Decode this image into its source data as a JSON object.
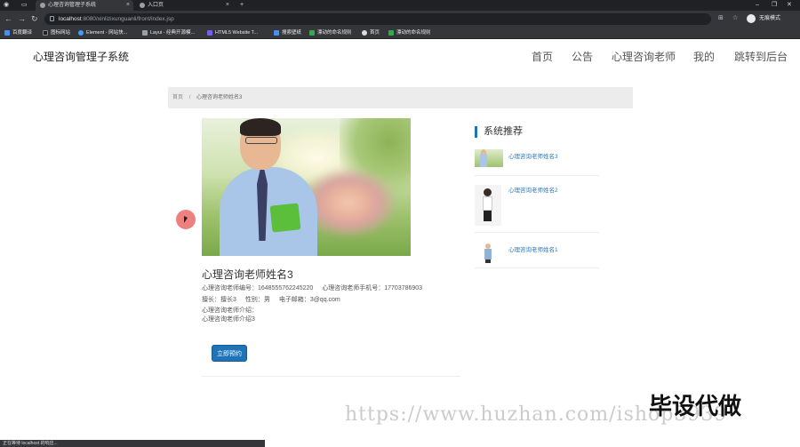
{
  "browser": {
    "tabs": [
      {
        "title": "心理咨询管理子系统"
      },
      {
        "title": "入口页"
      }
    ],
    "new_tab": "+",
    "url_host": "localhost",
    "url_path": ":8080/xinlizixunguanli/front/index.jsp",
    "profile_label": "无痕模式",
    "bookmarks": [
      "百度翻译",
      "图标网站",
      "Element - 网站快...",
      "Layui - 经典开源模...",
      "HTML5 Website T...",
      "搜索壁纸",
      "漂动的命名规则",
      "首页",
      "漂动的命名规则"
    ],
    "status_text": "正在等待 localhost 的响应..."
  },
  "header": {
    "site_title": "心理咨询管理子系统",
    "nav": [
      "首页",
      "公告",
      "心理咨询老师",
      "我的",
      "跳转到后台"
    ]
  },
  "breadcrumb": {
    "home": "首页",
    "sep": "/",
    "current": "心理咨询老师姓名3"
  },
  "detail": {
    "name": "心理咨询老师姓名3",
    "id_label": "心理咨询老师编号：",
    "id_value": "1648555762245220",
    "phone_label": "心理咨询老师手机号：",
    "phone_value": "17703786903",
    "skill_label": "擅长：",
    "skill_value": "擅长3",
    "gender_label": "性别：",
    "gender_value": "男",
    "email_label": "电子邮箱：",
    "email_value": "3@qq.com",
    "intro_label": "心理咨询老师介绍：",
    "intro_value": "心理咨询老师介绍3",
    "book_button": "立即预约"
  },
  "sidebar": {
    "title": "系统推荐",
    "items": [
      {
        "label": "心理咨询老师姓名3"
      },
      {
        "label": "心理咨询老师姓名2"
      },
      {
        "label": "心理咨询老师姓名1"
      }
    ]
  },
  "watermark": {
    "url": "https://www.huzhan.com/ishop3939",
    "text": "毕设代做"
  }
}
